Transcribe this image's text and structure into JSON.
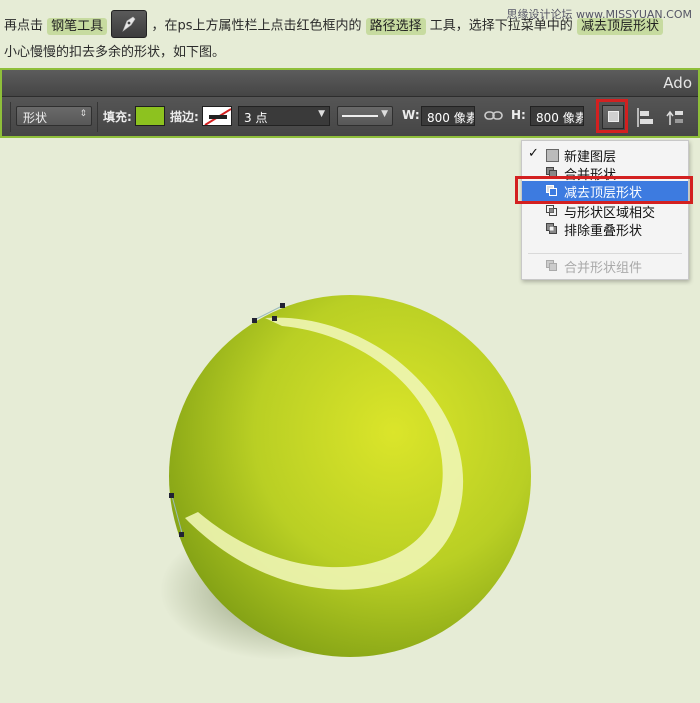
{
  "watermark": "思缘设计论坛 www.MISSYUAN.COM",
  "intro": {
    "part1": "再点击",
    "pen_tool": "钢笔工具",
    "part2": "，在ps上方属性栏上点击红色框内的",
    "path_select": "路径选择",
    "part3": "工具，选择下拉菜单中的",
    "subtract": "减去顶层形状",
    "part4": "小心慢慢的扣去多余的形状，如下图。"
  },
  "toolbar": {
    "app_title": "Ado",
    "shape_mode": "形状",
    "fill_label": "填充:",
    "stroke_label": "描边:",
    "stroke_size": "3 点",
    "w_label": "W:",
    "w_value": "800 像素",
    "h_label": "H:",
    "h_value": "800 像素",
    "fill_color": "#8dc21f",
    "accent_color": "#d32020"
  },
  "menu": {
    "items": [
      {
        "label": "新建图层",
        "checked": "✓"
      },
      {
        "label": "合并形状"
      },
      {
        "label": "减去顶层形状"
      },
      {
        "label": "与形状区域相交"
      },
      {
        "label": "排除重叠形状"
      },
      {
        "label": "合并形状组件"
      }
    ],
    "selected_color": "#3d7be0"
  }
}
